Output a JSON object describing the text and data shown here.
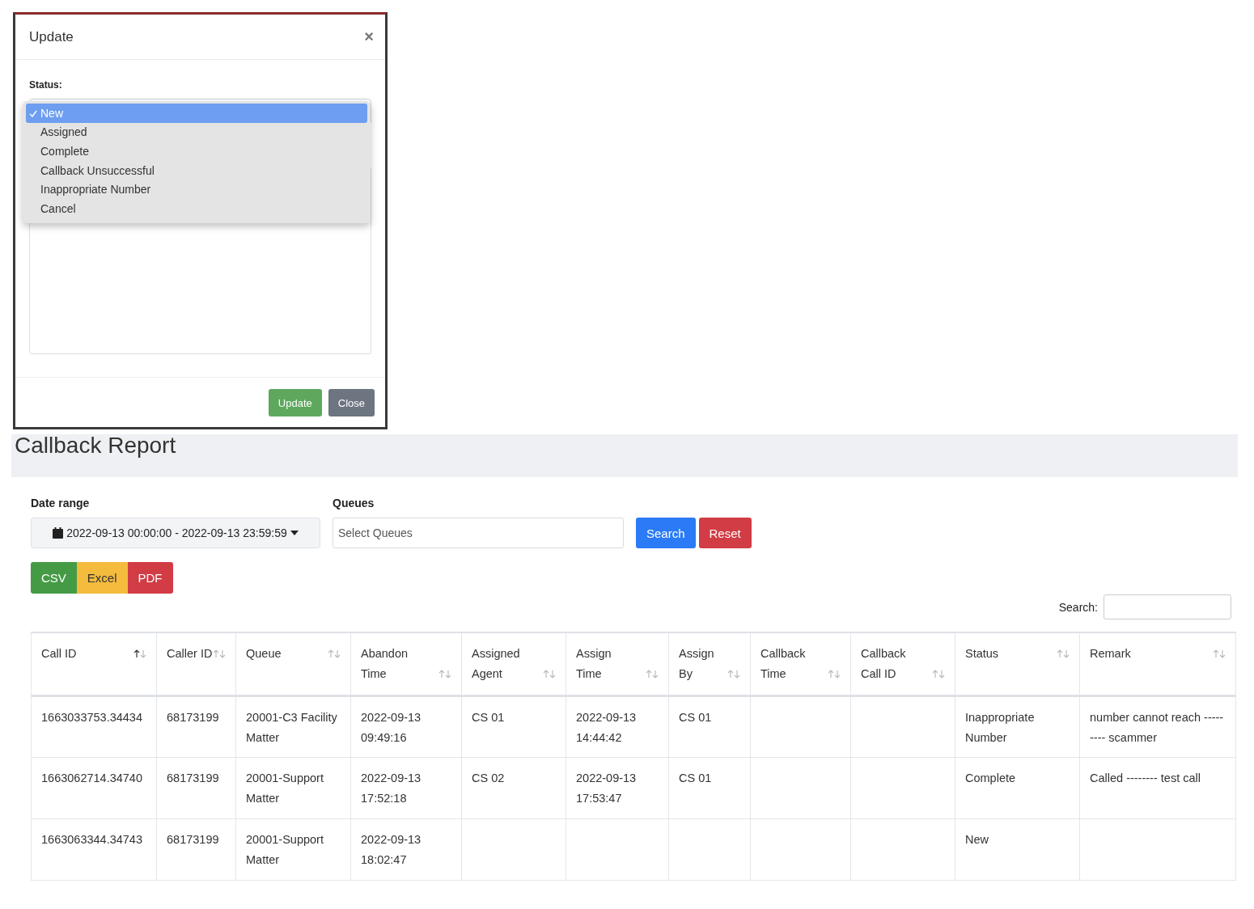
{
  "modal": {
    "title": "Update",
    "close": "×",
    "status_label": "Status:",
    "status_options": [
      {
        "label": "New",
        "selected": true
      },
      {
        "label": "Assigned",
        "selected": false
      },
      {
        "label": "Complete",
        "selected": false
      },
      {
        "label": "Callback Unsuccessful",
        "selected": false
      },
      {
        "label": "Inappropriate Number",
        "selected": false
      },
      {
        "label": "Cancel",
        "selected": false
      }
    ],
    "buttons": [
      {
        "label": "Update",
        "kind": "primary"
      },
      {
        "label": "Close",
        "kind": "secondary"
      }
    ]
  },
  "page": {
    "title": "Callback Report"
  },
  "filters": {
    "date_label": "Date range",
    "date_value": "2022-09-13 00:00:00 - 2022-09-13 23:59:59",
    "queues_label": "Queues",
    "queues_placeholder": "Select Queues",
    "buttons": [
      {
        "label": "Search",
        "kind": "search"
      },
      {
        "label": "Reset",
        "kind": "reset"
      }
    ]
  },
  "export_buttons": [
    {
      "label": "CSV",
      "kind": "csv"
    },
    {
      "label": "Excel",
      "kind": "excel"
    },
    {
      "label": "PDF",
      "kind": "pdf"
    }
  ],
  "table_search": {
    "label": "Search:"
  },
  "table": {
    "columns": [
      {
        "label": "Call ID",
        "sorted": true
      },
      {
        "label": "Caller ID",
        "sorted": false
      },
      {
        "label": "Queue",
        "sorted": false
      },
      {
        "label": "Abandon Time",
        "sorted": false
      },
      {
        "label": "Assigned Agent",
        "sorted": false
      },
      {
        "label": "Assign Time",
        "sorted": false
      },
      {
        "label": "Assign By",
        "sorted": false
      },
      {
        "label": "Callback Time",
        "sorted": false
      },
      {
        "label": "Callback Call ID",
        "sorted": false
      },
      {
        "label": "Status",
        "sorted": false
      },
      {
        "label": "Remark",
        "sorted": false
      }
    ],
    "rows": [
      {
        "call_id": "1663033753.34434",
        "caller_id": "68173199",
        "queue": "20001-C3 Facility Matter",
        "abandon_time": "2022-09-13 09:49:16",
        "assigned_agent": "CS 01",
        "assign_time": "2022-09-13 14:44:42",
        "assign_by": "CS 01",
        "status": "Inappropriate Number",
        "remark": "number cannot reach --------- scammer"
      },
      {
        "call_id": "1663062714.34740",
        "caller_id": "68173199",
        "queue": "20001-Support Matter",
        "abandon_time": "2022-09-13 17:52:18",
        "assigned_agent": "CS 02",
        "assign_time": "2022-09-13 17:53:47",
        "assign_by": "CS 01",
        "status": "Complete",
        "remark": "Called -------- test call"
      },
      {
        "call_id": "1663063344.34743",
        "caller_id": "68173199",
        "queue": "20001-Support Matter",
        "abandon_time": "2022-09-13 18:02:47",
        "status": "New"
      }
    ]
  }
}
